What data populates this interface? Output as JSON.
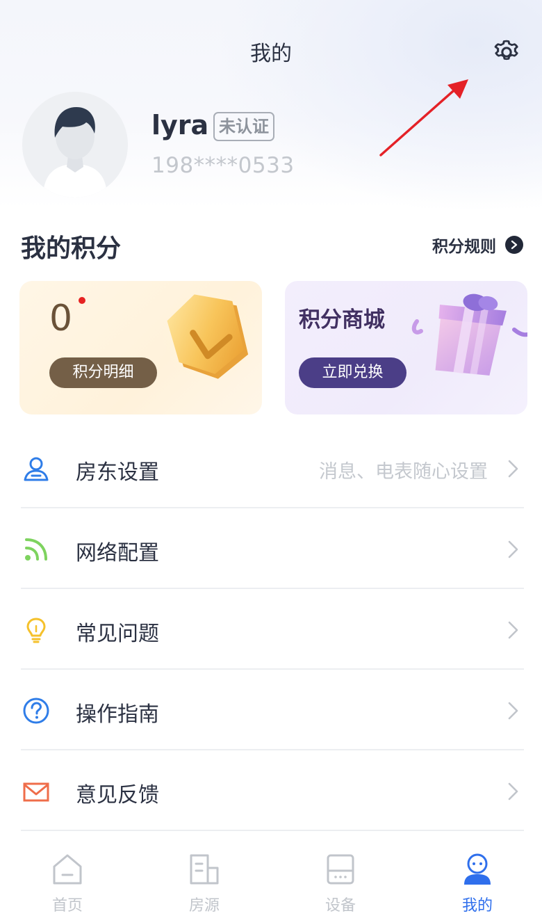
{
  "header": {
    "title": "我的",
    "settings_icon": "gear-icon"
  },
  "profile": {
    "username": "lyra",
    "verify_status": "未认证",
    "phone": "198****0533",
    "avatar_icon": "default-avatar"
  },
  "points": {
    "section_title": "我的积分",
    "rules_label": "积分规则",
    "rules_icon": "chevron-circle-right-icon",
    "value": "0",
    "detail_button": "积分明细",
    "mall_title": "积分商城",
    "exchange_button": "立即兑换"
  },
  "menu": [
    {
      "label": "房东设置",
      "desc": "消息、电表随心设置",
      "icon": "user-icon",
      "color": "#2f7de8"
    },
    {
      "label": "网络配置",
      "desc": "",
      "icon": "signal-icon",
      "color": "#7ed35f"
    },
    {
      "label": "常见问题",
      "desc": "",
      "icon": "lightbulb-icon",
      "color": "#f5c12b"
    },
    {
      "label": "操作指南",
      "desc": "",
      "icon": "question-circle-icon",
      "color": "#2f7de8"
    },
    {
      "label": "意见反馈",
      "desc": "",
      "icon": "mail-icon",
      "color": "#ef6d4a"
    }
  ],
  "tabbar": {
    "tabs": [
      {
        "label": "首页",
        "icon": "home-icon",
        "active": false
      },
      {
        "label": "房源",
        "icon": "building-icon",
        "active": false
      },
      {
        "label": "设备",
        "icon": "device-icon",
        "active": false
      },
      {
        "label": "我的",
        "icon": "profile-icon",
        "active": true
      }
    ]
  },
  "colors": {
    "accent": "#2f6fec",
    "text_primary": "#2b3142",
    "annotation_arrow": "#e42127"
  }
}
